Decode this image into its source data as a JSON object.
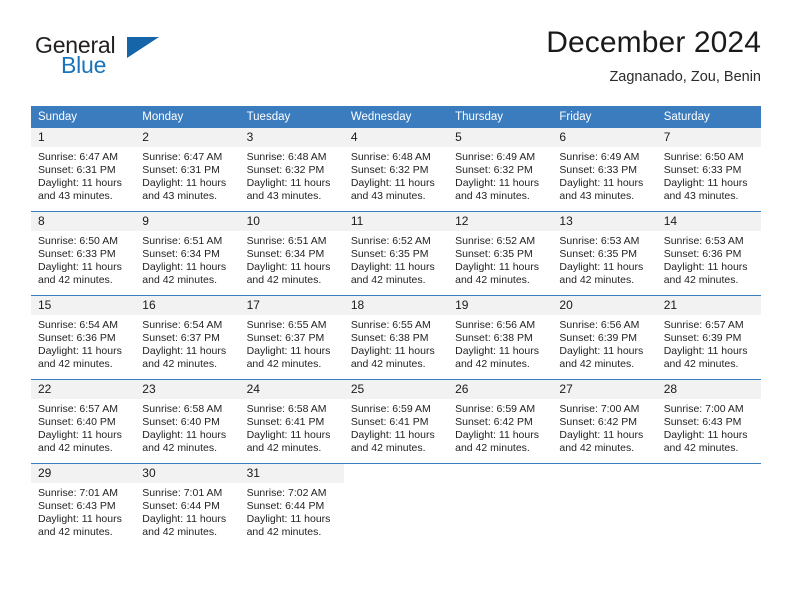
{
  "brand": {
    "name_top": "General",
    "name_bottom": "Blue",
    "triangle_color": "#1565a8",
    "blue_text_color": "#1a74bb"
  },
  "header": {
    "title": "December 2024",
    "subtitle": "Zagnanado, Zou, Benin"
  },
  "theme": {
    "header_bg": "#3a7cbe",
    "header_text": "#ffffff",
    "daynum_bg": "#f2f2f2",
    "cell_bg": "#ffffff",
    "grid_line": "#3a7cbe"
  },
  "weekday_headers": [
    "Sunday",
    "Monday",
    "Tuesday",
    "Wednesday",
    "Thursday",
    "Friday",
    "Saturday"
  ],
  "labels": {
    "sunrise_prefix": "Sunrise:",
    "sunset_prefix": "Sunset:",
    "daylight_prefix": "Daylight:"
  },
  "weeks": [
    [
      {
        "day": "1",
        "sunrise": "Sunrise: 6:47 AM",
        "sunset": "Sunset: 6:31 PM",
        "daylight": "Daylight: 11 hours and 43 minutes."
      },
      {
        "day": "2",
        "sunrise": "Sunrise: 6:47 AM",
        "sunset": "Sunset: 6:31 PM",
        "daylight": "Daylight: 11 hours and 43 minutes."
      },
      {
        "day": "3",
        "sunrise": "Sunrise: 6:48 AM",
        "sunset": "Sunset: 6:32 PM",
        "daylight": "Daylight: 11 hours and 43 minutes."
      },
      {
        "day": "4",
        "sunrise": "Sunrise: 6:48 AM",
        "sunset": "Sunset: 6:32 PM",
        "daylight": "Daylight: 11 hours and 43 minutes."
      },
      {
        "day": "5",
        "sunrise": "Sunrise: 6:49 AM",
        "sunset": "Sunset: 6:32 PM",
        "daylight": "Daylight: 11 hours and 43 minutes."
      },
      {
        "day": "6",
        "sunrise": "Sunrise: 6:49 AM",
        "sunset": "Sunset: 6:33 PM",
        "daylight": "Daylight: 11 hours and 43 minutes."
      },
      {
        "day": "7",
        "sunrise": "Sunrise: 6:50 AM",
        "sunset": "Sunset: 6:33 PM",
        "daylight": "Daylight: 11 hours and 43 minutes."
      }
    ],
    [
      {
        "day": "8",
        "sunrise": "Sunrise: 6:50 AM",
        "sunset": "Sunset: 6:33 PM",
        "daylight": "Daylight: 11 hours and 42 minutes."
      },
      {
        "day": "9",
        "sunrise": "Sunrise: 6:51 AM",
        "sunset": "Sunset: 6:34 PM",
        "daylight": "Daylight: 11 hours and 42 minutes."
      },
      {
        "day": "10",
        "sunrise": "Sunrise: 6:51 AM",
        "sunset": "Sunset: 6:34 PM",
        "daylight": "Daylight: 11 hours and 42 minutes."
      },
      {
        "day": "11",
        "sunrise": "Sunrise: 6:52 AM",
        "sunset": "Sunset: 6:35 PM",
        "daylight": "Daylight: 11 hours and 42 minutes."
      },
      {
        "day": "12",
        "sunrise": "Sunrise: 6:52 AM",
        "sunset": "Sunset: 6:35 PM",
        "daylight": "Daylight: 11 hours and 42 minutes."
      },
      {
        "day": "13",
        "sunrise": "Sunrise: 6:53 AM",
        "sunset": "Sunset: 6:35 PM",
        "daylight": "Daylight: 11 hours and 42 minutes."
      },
      {
        "day": "14",
        "sunrise": "Sunrise: 6:53 AM",
        "sunset": "Sunset: 6:36 PM",
        "daylight": "Daylight: 11 hours and 42 minutes."
      }
    ],
    [
      {
        "day": "15",
        "sunrise": "Sunrise: 6:54 AM",
        "sunset": "Sunset: 6:36 PM",
        "daylight": "Daylight: 11 hours and 42 minutes."
      },
      {
        "day": "16",
        "sunrise": "Sunrise: 6:54 AM",
        "sunset": "Sunset: 6:37 PM",
        "daylight": "Daylight: 11 hours and 42 minutes."
      },
      {
        "day": "17",
        "sunrise": "Sunrise: 6:55 AM",
        "sunset": "Sunset: 6:37 PM",
        "daylight": "Daylight: 11 hours and 42 minutes."
      },
      {
        "day": "18",
        "sunrise": "Sunrise: 6:55 AM",
        "sunset": "Sunset: 6:38 PM",
        "daylight": "Daylight: 11 hours and 42 minutes."
      },
      {
        "day": "19",
        "sunrise": "Sunrise: 6:56 AM",
        "sunset": "Sunset: 6:38 PM",
        "daylight": "Daylight: 11 hours and 42 minutes."
      },
      {
        "day": "20",
        "sunrise": "Sunrise: 6:56 AM",
        "sunset": "Sunset: 6:39 PM",
        "daylight": "Daylight: 11 hours and 42 minutes."
      },
      {
        "day": "21",
        "sunrise": "Sunrise: 6:57 AM",
        "sunset": "Sunset: 6:39 PM",
        "daylight": "Daylight: 11 hours and 42 minutes."
      }
    ],
    [
      {
        "day": "22",
        "sunrise": "Sunrise: 6:57 AM",
        "sunset": "Sunset: 6:40 PM",
        "daylight": "Daylight: 11 hours and 42 minutes."
      },
      {
        "day": "23",
        "sunrise": "Sunrise: 6:58 AM",
        "sunset": "Sunset: 6:40 PM",
        "daylight": "Daylight: 11 hours and 42 minutes."
      },
      {
        "day": "24",
        "sunrise": "Sunrise: 6:58 AM",
        "sunset": "Sunset: 6:41 PM",
        "daylight": "Daylight: 11 hours and 42 minutes."
      },
      {
        "day": "25",
        "sunrise": "Sunrise: 6:59 AM",
        "sunset": "Sunset: 6:41 PM",
        "daylight": "Daylight: 11 hours and 42 minutes."
      },
      {
        "day": "26",
        "sunrise": "Sunrise: 6:59 AM",
        "sunset": "Sunset: 6:42 PM",
        "daylight": "Daylight: 11 hours and 42 minutes."
      },
      {
        "day": "27",
        "sunrise": "Sunrise: 7:00 AM",
        "sunset": "Sunset: 6:42 PM",
        "daylight": "Daylight: 11 hours and 42 minutes."
      },
      {
        "day": "28",
        "sunrise": "Sunrise: 7:00 AM",
        "sunset": "Sunset: 6:43 PM",
        "daylight": "Daylight: 11 hours and 42 minutes."
      }
    ],
    [
      {
        "day": "29",
        "sunrise": "Sunrise: 7:01 AM",
        "sunset": "Sunset: 6:43 PM",
        "daylight": "Daylight: 11 hours and 42 minutes."
      },
      {
        "day": "30",
        "sunrise": "Sunrise: 7:01 AM",
        "sunset": "Sunset: 6:44 PM",
        "daylight": "Daylight: 11 hours and 42 minutes."
      },
      {
        "day": "31",
        "sunrise": "Sunrise: 7:02 AM",
        "sunset": "Sunset: 6:44 PM",
        "daylight": "Daylight: 11 hours and 42 minutes."
      },
      {
        "day": "",
        "sunrise": "",
        "sunset": "",
        "daylight": ""
      },
      {
        "day": "",
        "sunrise": "",
        "sunset": "",
        "daylight": ""
      },
      {
        "day": "",
        "sunrise": "",
        "sunset": "",
        "daylight": ""
      },
      {
        "day": "",
        "sunrise": "",
        "sunset": "",
        "daylight": ""
      }
    ]
  ]
}
